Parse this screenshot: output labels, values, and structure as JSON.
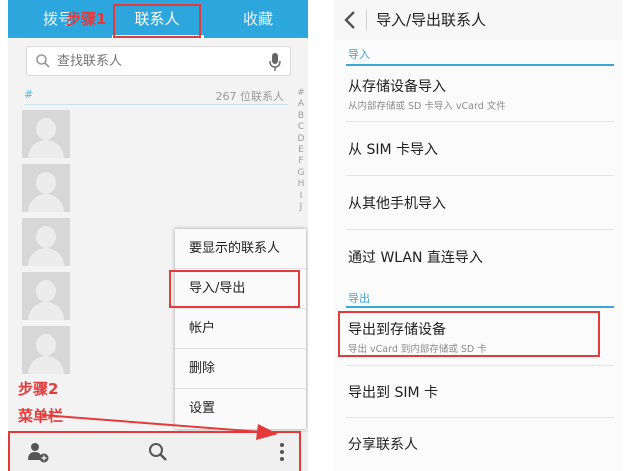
{
  "left_screen": {
    "tabs": [
      {
        "label": "拨号"
      },
      {
        "label": "联系人"
      },
      {
        "label": "收藏"
      }
    ],
    "search": {
      "placeholder": "查找联系人"
    },
    "index_header": {
      "symbol": "#",
      "count_label": "267 位联系人"
    },
    "alphabet": [
      "A",
      "B",
      "C",
      "D",
      "E",
      "F",
      "G",
      "H",
      "I",
      "J"
    ],
    "menu": {
      "items": [
        {
          "label": "要显示的联系人"
        },
        {
          "label": "导入/导出"
        },
        {
          "label": "帐户"
        },
        {
          "label": "删除"
        },
        {
          "label": "设置"
        }
      ]
    },
    "bottom_bar": {
      "icons": [
        "add-contact-icon",
        "search-icon",
        "overflow-menu-icon"
      ]
    }
  },
  "annotations": {
    "step1": "步骤1",
    "step2_line1": "步骤2",
    "step2_line2": "菜单栏",
    "accent_color": "#e53a3a"
  },
  "right_screen": {
    "title": "导入/导出联系人",
    "import_section": {
      "header": "导入",
      "items": [
        {
          "label": "从存储设备导入",
          "sub": "从内部存储或 SD 卡导入 vCard 文件"
        },
        {
          "label": "从 SIM 卡导入"
        },
        {
          "label": "从其他手机导入"
        },
        {
          "label": "通过 WLAN 直连导入"
        }
      ]
    },
    "export_section": {
      "header": "导出",
      "items": [
        {
          "label": "导出到存储设备",
          "sub": "导出 vCard 到内部存储或 SD 卡"
        },
        {
          "label": "导出到 SIM 卡"
        },
        {
          "label": "分享联系人"
        }
      ]
    }
  },
  "colors": {
    "tab_bar": "#2da6dd",
    "section_header": "#3aa7d9",
    "highlight_box": "#e53a3a"
  }
}
